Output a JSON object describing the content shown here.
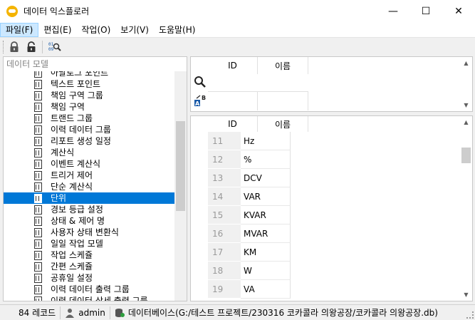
{
  "window": {
    "title": "데이터 익스플로러",
    "minimize": "—",
    "maximize": "☐",
    "close": "✕"
  },
  "menu": [
    {
      "label": "파일(F)"
    },
    {
      "label": "편집(E)"
    },
    {
      "label": "작업(O)"
    },
    {
      "label": "보기(V)"
    },
    {
      "label": "도움말(H)"
    }
  ],
  "toolbar": {
    "icons": [
      "lock-icon",
      "unlock-icon",
      "find-id-icon"
    ]
  },
  "left_panel": {
    "header": "데이터 모델",
    "items": [
      {
        "label": "아날로그 포인트"
      },
      {
        "label": "텍스트 포인트"
      },
      {
        "label": "책임 구역 그룹"
      },
      {
        "label": "책임 구역"
      },
      {
        "label": "트랜드 그룹"
      },
      {
        "label": "이력 데이터 그룹"
      },
      {
        "label": "리포트 생성 일정"
      },
      {
        "label": "계산식"
      },
      {
        "label": "이벤트 계산식"
      },
      {
        "label": "트리거 제어"
      },
      {
        "label": "단순 계산식"
      },
      {
        "label": "단위",
        "selected": true
      },
      {
        "label": "경보 등급 설정"
      },
      {
        "label": "상태 & 제어 명"
      },
      {
        "label": "사용자 상태 변환식"
      },
      {
        "label": "일일 작업 모델"
      },
      {
        "label": "작업 스케쥴"
      },
      {
        "label": "간편 스케쥴"
      },
      {
        "label": "공휴일 설정"
      },
      {
        "label": "이력 데이터 출력 그룹"
      },
      {
        "label": "이력 데이터 상세 출력 그룹"
      }
    ]
  },
  "right_top": {
    "columns": [
      "ID",
      "이름"
    ],
    "icons": [
      "search-icon",
      "sort-az-icon"
    ]
  },
  "right_bottom": {
    "columns": [
      "ID",
      "이름"
    ],
    "rows": [
      {
        "id": "11",
        "name": "Hz"
      },
      {
        "id": "12",
        "name": "%"
      },
      {
        "id": "13",
        "name": "DCV"
      },
      {
        "id": "14",
        "name": "VAR"
      },
      {
        "id": "15",
        "name": "KVAR"
      },
      {
        "id": "16",
        "name": "MVAR"
      },
      {
        "id": "17",
        "name": "KM"
      },
      {
        "id": "18",
        "name": "W"
      },
      {
        "id": "19",
        "name": "VA"
      }
    ]
  },
  "status": {
    "records": "84 레코드",
    "user": "admin",
    "database": "데이터베이스(G:/테스트 프로젝트/230316 코카콜라 의왕공장/코카콜라 의왕공장.db)"
  },
  "colors": {
    "selection": "#0078d7",
    "menu_active": "#cce8ff"
  }
}
